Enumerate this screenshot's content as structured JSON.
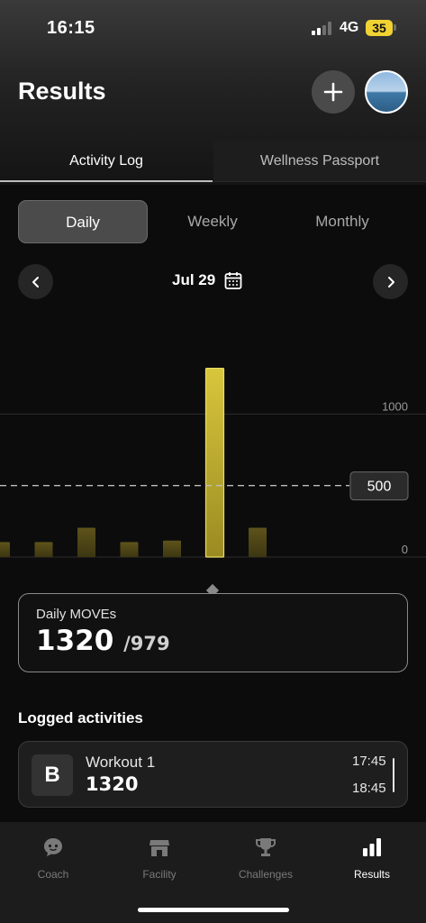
{
  "status_bar": {
    "time": "16:15",
    "network": "4G",
    "battery": "35"
  },
  "header": {
    "title": "Results"
  },
  "tabs": [
    {
      "label": "Activity Log",
      "active": true
    },
    {
      "label": "Wellness Passport",
      "active": false
    }
  ],
  "period_tabs": [
    {
      "label": "Daily",
      "active": true
    },
    {
      "label": "Weekly",
      "active": false
    },
    {
      "label": "Monthly",
      "active": false
    }
  ],
  "date_nav": {
    "date": "Jul 29"
  },
  "chart_data": {
    "type": "bar",
    "values": [
      105,
      105,
      205,
      105,
      115,
      1320,
      205
    ],
    "selected_index": 5,
    "y_ticks": [
      "0",
      "1000"
    ],
    "ylim": [
      0,
      1500
    ],
    "goal_line": {
      "value": 500,
      "label": "500"
    },
    "colors": {
      "bar": "#6b5e1c",
      "selected": "#d4c235",
      "grid": "#2c2c2c"
    }
  },
  "moves_card": {
    "title": "Daily MOVEs",
    "value": "1320",
    "goal": "/979"
  },
  "logged": {
    "title": "Logged activities",
    "items": [
      {
        "badge": "B",
        "name": "Workout 1",
        "value": "1320",
        "start": "17:45",
        "end": "18:45"
      }
    ]
  },
  "bottom_nav": [
    {
      "label": "Coach",
      "icon": "coach-chat-icon",
      "active": false
    },
    {
      "label": "Facility",
      "icon": "storefront-icon",
      "active": false
    },
    {
      "label": "Challenges",
      "icon": "trophy-icon",
      "active": false
    },
    {
      "label": "Results",
      "icon": "bar-chart-icon",
      "active": true
    }
  ]
}
